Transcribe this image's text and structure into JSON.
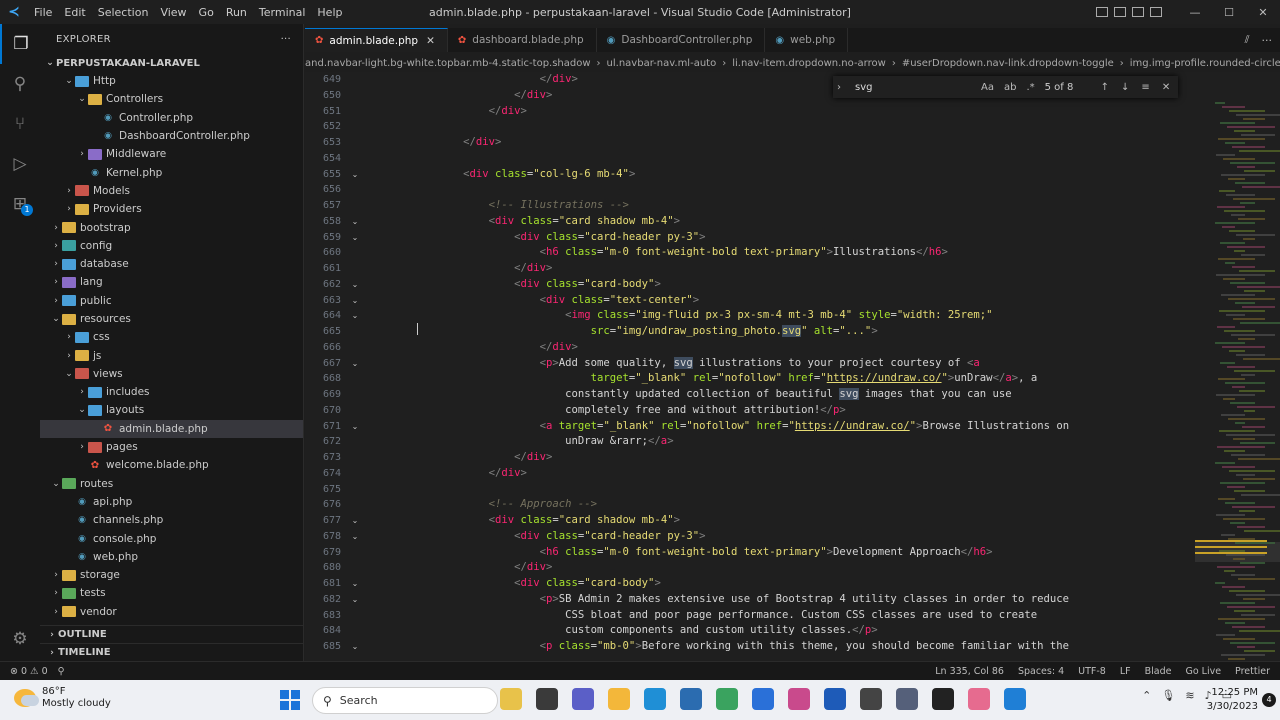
{
  "titlebar": {
    "menu": [
      "File",
      "Edit",
      "Selection",
      "View",
      "Go",
      "Run",
      "Terminal",
      "Help"
    ],
    "title": "admin.blade.php - perpustakaan-laravel - Visual Studio Code [Administrator]"
  },
  "sidebar": {
    "header": "EXPLORER",
    "project": "PERPUSTAKAAN-LARAVEL",
    "items": [
      {
        "label": "Http",
        "depth": 1,
        "kind": "folder",
        "open": true,
        "color": "blue"
      },
      {
        "label": "Controllers",
        "depth": 2,
        "kind": "folder",
        "open": true,
        "color": "yellow"
      },
      {
        "label": "Controller.php",
        "depth": 3,
        "kind": "php"
      },
      {
        "label": "DashboardController.php",
        "depth": 3,
        "kind": "php"
      },
      {
        "label": "Middleware",
        "depth": 2,
        "kind": "folder",
        "open": false,
        "color": "purple"
      },
      {
        "label": "Kernel.php",
        "depth": 2,
        "kind": "php"
      },
      {
        "label": "Models",
        "depth": 1,
        "kind": "folder",
        "open": false,
        "color": "red"
      },
      {
        "label": "Providers",
        "depth": 1,
        "kind": "folder",
        "open": false,
        "color": "yellow"
      },
      {
        "label": "bootstrap",
        "depth": 0,
        "kind": "folder",
        "open": false,
        "color": "yellow"
      },
      {
        "label": "config",
        "depth": 0,
        "kind": "folder",
        "open": false,
        "color": "teal"
      },
      {
        "label": "database",
        "depth": 0,
        "kind": "folder",
        "open": false,
        "color": "blue"
      },
      {
        "label": "lang",
        "depth": 0,
        "kind": "folder",
        "open": false,
        "color": "purple"
      },
      {
        "label": "public",
        "depth": 0,
        "kind": "folder",
        "open": false,
        "color": "blue"
      },
      {
        "label": "resources",
        "depth": 0,
        "kind": "folder",
        "open": true,
        "color": "yellow"
      },
      {
        "label": "css",
        "depth": 1,
        "kind": "folder",
        "open": false,
        "color": "blue"
      },
      {
        "label": "js",
        "depth": 1,
        "kind": "folder",
        "open": false,
        "color": "yellow"
      },
      {
        "label": "views",
        "depth": 1,
        "kind": "folder",
        "open": true,
        "color": "red"
      },
      {
        "label": "includes",
        "depth": 2,
        "kind": "folder",
        "open": false,
        "color": "blue"
      },
      {
        "label": "layouts",
        "depth": 2,
        "kind": "folder",
        "open": true,
        "color": "blue"
      },
      {
        "label": "admin.blade.php",
        "depth": 3,
        "kind": "blade",
        "selected": true
      },
      {
        "label": "pages",
        "depth": 2,
        "kind": "folder",
        "open": false,
        "color": "red"
      },
      {
        "label": "welcome.blade.php",
        "depth": 2,
        "kind": "blade"
      },
      {
        "label": "routes",
        "depth": 0,
        "kind": "folder",
        "open": true,
        "color": "green"
      },
      {
        "label": "api.php",
        "depth": 1,
        "kind": "php"
      },
      {
        "label": "channels.php",
        "depth": 1,
        "kind": "php"
      },
      {
        "label": "console.php",
        "depth": 1,
        "kind": "php"
      },
      {
        "label": "web.php",
        "depth": 1,
        "kind": "php"
      },
      {
        "label": "storage",
        "depth": 0,
        "kind": "folder",
        "open": false,
        "color": "yellow"
      },
      {
        "label": "tests",
        "depth": 0,
        "kind": "folder",
        "open": false,
        "color": "green"
      },
      {
        "label": "vendor",
        "depth": 0,
        "kind": "folder",
        "open": false,
        "color": "yellow"
      }
    ],
    "outline": "OUTLINE",
    "timeline": "TIMELINE"
  },
  "tabs": [
    {
      "label": "admin.blade.php",
      "kind": "blade",
      "active": true
    },
    {
      "label": "dashboard.blade.php",
      "kind": "blade",
      "active": false
    },
    {
      "label": "DashboardController.php",
      "kind": "php",
      "active": false
    },
    {
      "label": "web.php",
      "kind": "php",
      "active": false
    }
  ],
  "breadcrumb": [
    "and.navbar-light.bg-white.topbar.mb-4.static-top.shadow",
    "ul.navbar-nav.ml-auto",
    "li.nav-item.dropdown.no-arrow",
    "#userDropdown.nav-link.dropdown-toggle",
    "img.img-profile.rounded-circle"
  ],
  "find": {
    "query": "svg",
    "count": "5 of 8"
  },
  "editor": {
    "first_line": 649,
    "lines": [
      {
        "n": "649",
        "fold": false,
        "html": "                            <span class='br'>&lt;/</span><span class='tag'>div</span><span class='br'>&gt;</span>"
      },
      {
        "n": "650",
        "fold": false,
        "html": "                        <span class='br'>&lt;/</span><span class='tag'>div</span><span class='br'>&gt;</span>"
      },
      {
        "n": "651",
        "fold": false,
        "html": "                    <span class='br'>&lt;/</span><span class='tag'>div</span><span class='br'>&gt;</span>"
      },
      {
        "n": "652",
        "fold": false,
        "html": ""
      },
      {
        "n": "653",
        "fold": false,
        "html": "                <span class='br'>&lt;/</span><span class='tag'>div</span><span class='br'>&gt;</span>"
      },
      {
        "n": "654",
        "fold": false,
        "html": ""
      },
      {
        "n": "655",
        "fold": true,
        "html": "                <span class='br'>&lt;</span><span class='tag'>div</span> <span class='at'>class</span>=<span class='st'>\"col-lg-6 mb-4\"</span><span class='br'>&gt;</span>"
      },
      {
        "n": "656",
        "fold": false,
        "html": ""
      },
      {
        "n": "657",
        "fold": false,
        "html": "                    <span class='cm'>&lt;!-- Illustrations --&gt;</span>"
      },
      {
        "n": "658",
        "fold": true,
        "html": "                    <span class='br'>&lt;</span><span class='tag'>div</span> <span class='at'>class</span>=<span class='st'>\"card shadow mb-4\"</span><span class='br'>&gt;</span>"
      },
      {
        "n": "659",
        "fold": true,
        "html": "                        <span class='br'>&lt;</span><span class='tag'>div</span> <span class='at'>class</span>=<span class='st'>\"card-header py-3\"</span><span class='br'>&gt;</span>"
      },
      {
        "n": "660",
        "fold": false,
        "html": "                            <span class='br'>&lt;</span><span class='tag'>h6</span> <span class='at'>class</span>=<span class='st'>\"m-0 font-weight-bold text-primary\"</span><span class='br'>&gt;</span><span class='tx'>Illustrations</span><span class='br'>&lt;/</span><span class='tag'>h6</span><span class='br'>&gt;</span>"
      },
      {
        "n": "661",
        "fold": false,
        "html": "                        <span class='br'>&lt;/</span><span class='tag'>div</span><span class='br'>&gt;</span>"
      },
      {
        "n": "662",
        "fold": true,
        "html": "                        <span class='br'>&lt;</span><span class='tag'>div</span> <span class='at'>class</span>=<span class='st'>\"card-body\"</span><span class='br'>&gt;</span>"
      },
      {
        "n": "663",
        "fold": true,
        "html": "                            <span class='br'>&lt;</span><span class='tag'>div</span> <span class='at'>class</span>=<span class='st'>\"text-center\"</span><span class='br'>&gt;</span>"
      },
      {
        "n": "664",
        "fold": true,
        "html": "                                <span class='br'>&lt;</span><span class='tag'>img</span> <span class='at'>class</span>=<span class='st'>\"img-fluid px-3 px-sm-4 mt-3 mb-4\"</span> <span class='at'>style</span>=<span class='st'>\"width: 25rem;\"</span>"
      },
      {
        "n": "665",
        "fold": false,
        "html": "                                    <span class='at'>src</span>=<span class='st'>\"img/undraw_posting_photo.<span class='hl'>svg</span>\"</span> <span class='at'>alt</span>=<span class='st'>\"...\"</span><span class='br'>&gt;</span>"
      },
      {
        "n": "666",
        "fold": false,
        "html": "                            <span class='br'>&lt;/</span><span class='tag'>div</span><span class='br'>&gt;</span>"
      },
      {
        "n": "667",
        "fold": true,
        "html": "                            <span class='br'>&lt;</span><span class='tag'>p</span><span class='br'>&gt;</span><span class='tx'>Add some quality, <span class='hl'>svg</span> illustrations to your project courtesy of </span><span class='br'>&lt;</span><span class='tag'>a</span>"
      },
      {
        "n": "668",
        "fold": false,
        "html": "                                    <span class='at'>target</span>=<span class='st'>\"_blank\"</span> <span class='at'>rel</span>=<span class='st'>\"nofollow\"</span> <span class='at'>href</span>=<span class='st'>\"<span class='ur'>https://undraw.co/</span>\"</span><span class='br'>&gt;</span><span class='tx'>unDraw</span><span class='br'>&lt;/</span><span class='tag'>a</span><span class='br'>&gt;</span><span class='tx'>, a</span>"
      },
      {
        "n": "669",
        "fold": false,
        "html": "                                <span class='tx'>constantly updated collection of beautiful <span class='hl'>svg</span> images that you can use</span>"
      },
      {
        "n": "670",
        "fold": false,
        "html": "                                <span class='tx'>completely free and without attribution!</span><span class='br'>&lt;/</span><span class='tag'>p</span><span class='br'>&gt;</span>"
      },
      {
        "n": "671",
        "fold": true,
        "html": "                            <span class='br'>&lt;</span><span class='tag'>a</span> <span class='at'>target</span>=<span class='st'>\"_blank\"</span> <span class='at'>rel</span>=<span class='st'>\"nofollow\"</span> <span class='at'>href</span>=<span class='st'>\"<span class='ur'>https://undraw.co/</span>\"</span><span class='br'>&gt;</span><span class='tx'>Browse Illustrations on</span>"
      },
      {
        "n": "672",
        "fold": false,
        "html": "                                <span class='tx'>unDraw &amp;rarr;</span><span class='br'>&lt;/</span><span class='tag'>a</span><span class='br'>&gt;</span>"
      },
      {
        "n": "673",
        "fold": false,
        "html": "                        <span class='br'>&lt;/</span><span class='tag'>div</span><span class='br'>&gt;</span>"
      },
      {
        "n": "674",
        "fold": false,
        "html": "                    <span class='br'>&lt;/</span><span class='tag'>div</span><span class='br'>&gt;</span>"
      },
      {
        "n": "675",
        "fold": false,
        "html": ""
      },
      {
        "n": "676",
        "fold": false,
        "html": "                    <span class='cm'>&lt;!-- Approach --&gt;</span>"
      },
      {
        "n": "677",
        "fold": true,
        "html": "                    <span class='br'>&lt;</span><span class='tag'>div</span> <span class='at'>class</span>=<span class='st'>\"card shadow mb-4\"</span><span class='br'>&gt;</span>"
      },
      {
        "n": "678",
        "fold": true,
        "html": "                        <span class='br'>&lt;</span><span class='tag'>div</span> <span class='at'>class</span>=<span class='st'>\"card-header py-3\"</span><span class='br'>&gt;</span>"
      },
      {
        "n": "679",
        "fold": false,
        "html": "                            <span class='br'>&lt;</span><span class='tag'>h6</span> <span class='at'>class</span>=<span class='st'>\"m-0 font-weight-bold text-primary\"</span><span class='br'>&gt;</span><span class='tx'>Development Approach</span><span class='br'>&lt;/</span><span class='tag'>h6</span><span class='br'>&gt;</span>"
      },
      {
        "n": "680",
        "fold": false,
        "html": "                        <span class='br'>&lt;/</span><span class='tag'>div</span><span class='br'>&gt;</span>"
      },
      {
        "n": "681",
        "fold": true,
        "html": "                        <span class='br'>&lt;</span><span class='tag'>div</span> <span class='at'>class</span>=<span class='st'>\"card-body\"</span><span class='br'>&gt;</span>"
      },
      {
        "n": "682",
        "fold": true,
        "html": "                            <span class='br'>&lt;</span><span class='tag'>p</span><span class='br'>&gt;</span><span class='tx'>SB Admin 2 makes extensive use of Bootstrap 4 utility classes in order to reduce</span>"
      },
      {
        "n": "683",
        "fold": false,
        "html": "                                <span class='tx'>CSS bloat and poor page performance. Custom CSS classes are used to create</span>"
      },
      {
        "n": "684",
        "fold": false,
        "html": "                                <span class='tx'>custom components and custom utility classes.</span><span class='br'>&lt;/</span><span class='tag'>p</span><span class='br'>&gt;</span>"
      },
      {
        "n": "685",
        "fold": true,
        "html": "                            <span class='br'>&lt;</span><span class='tag'>p</span> <span class='at'>class</span>=<span class='st'>\"mb-0\"</span><span class='br'>&gt;</span><span class='tx'>Before working with this theme, you should become familiar with the</span>"
      }
    ]
  },
  "status": {
    "left": [
      "⊗ 0 ⚠ 0",
      "⚲"
    ],
    "right": [
      "Ln 335, Col 86",
      "Spaces: 4",
      "UTF-8",
      "LF",
      "Blade",
      "Go Live",
      "Prettier"
    ]
  },
  "taskbar": {
    "temp": "86°F",
    "weather": "Mostly cloudy",
    "search": "Search",
    "time": "12:25 PM",
    "date": "3/30/2023",
    "notifications": "4"
  },
  "colors": {
    "accent": "#0078d4",
    "editor_bg": "#1f1f1f",
    "tag": "#f92672",
    "attr": "#a6e22e",
    "string": "#e6db74"
  }
}
